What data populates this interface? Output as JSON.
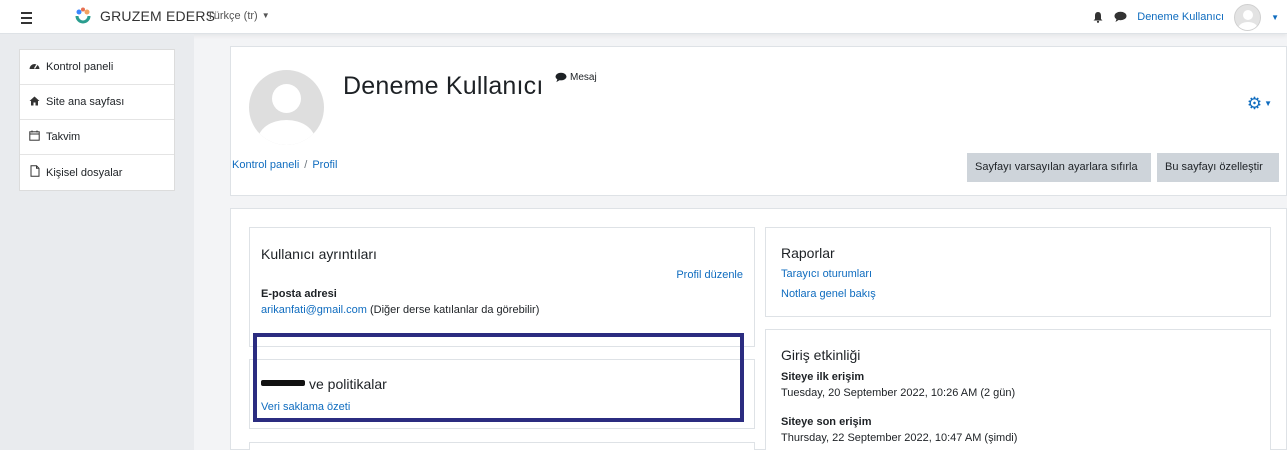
{
  "navbar": {
    "brand": "GRUZEM EDERS",
    "language": "Türkçe (tr)",
    "user_name": "Deneme Kullanıcı"
  },
  "sidebar": {
    "items": [
      {
        "label": "Kontrol paneli",
        "icon": "dashboard-icon"
      },
      {
        "label": "Site ana sayfası",
        "icon": "home-icon"
      },
      {
        "label": "Takvim",
        "icon": "calendar-icon"
      },
      {
        "label": "Kişisel dosyalar",
        "icon": "file-icon"
      }
    ]
  },
  "header": {
    "name": "Deneme Kullanıcı",
    "message_label": "Mesaj",
    "breadcrumb": [
      "Kontrol paneli",
      "Profil"
    ],
    "reset_button": "Sayfayı varsayılan ayarlara sıfırla",
    "customize_button": "Bu sayfayı özelleştir"
  },
  "user_details": {
    "title": "Kullanıcı ayrıntıları",
    "edit_link": "Profil düzenle",
    "email_label": "E-posta adresi",
    "email": "arikanfati@gmail.com",
    "email_note": "(Diğer derse katılanlar da görebilir)"
  },
  "privacy": {
    "title_visible": "ve politikalar",
    "link": "Veri saklama özeti"
  },
  "reports": {
    "title": "Raporlar",
    "links": [
      "Tarayıcı oturumları",
      "Notlara genel bakış"
    ]
  },
  "login_activity": {
    "title": "Giriş etkinliği",
    "first_label": "Siteye ilk erişim",
    "first_value": "Tuesday, 20 September 2022, 10:26 AM  (2 gün)",
    "last_label": "Siteye son erişim",
    "last_value": "Thursday, 22 September 2022, 10:47 AM  (şimdi)"
  },
  "colors": {
    "link": "#0f6cbf",
    "highlight_border": "#2b2c80",
    "button_bg": "#ced4da"
  }
}
